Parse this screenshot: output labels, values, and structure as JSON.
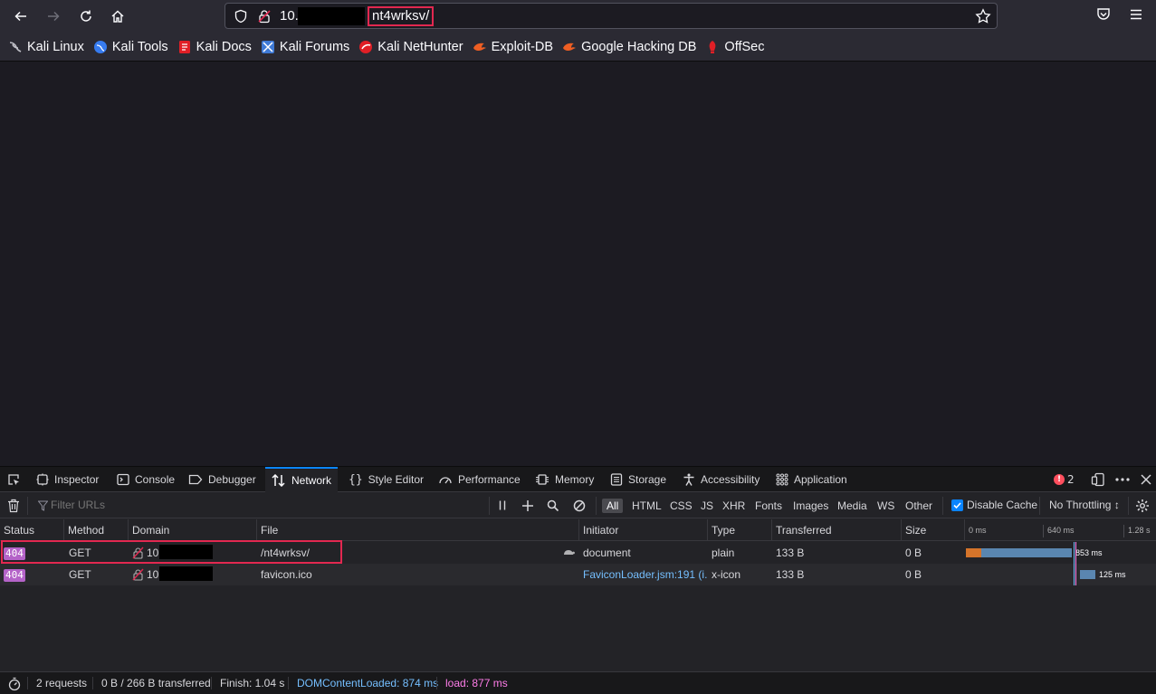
{
  "url": {
    "prefix": "10.",
    "path": "nt4wrksv/"
  },
  "bookmarks": [
    {
      "label": "Kali Linux",
      "icon": "kali-dragon-icon",
      "color": "#c0c0c8"
    },
    {
      "label": "Kali Tools",
      "icon": "kali-tools-icon",
      "color": "#367bf0"
    },
    {
      "label": "Kali Docs",
      "icon": "kali-docs-icon",
      "color": "#e01f26"
    },
    {
      "label": "Kali Forums",
      "icon": "kali-forums-icon",
      "color": "#3f7ad6"
    },
    {
      "label": "Kali NetHunter",
      "icon": "kali-nethunter-icon",
      "color": "#e01f26"
    },
    {
      "label": "Exploit-DB",
      "icon": "exploit-db-icon",
      "color": "#ee5e23"
    },
    {
      "label": "Google Hacking DB",
      "icon": "ghdb-icon",
      "color": "#ee5e23"
    },
    {
      "label": "OffSec",
      "icon": "offsec-icon",
      "color": "#e01f26"
    }
  ],
  "devtools": {
    "tabs": [
      "Inspector",
      "Console",
      "Debugger",
      "Network",
      "Style Editor",
      "Performance",
      "Memory",
      "Storage",
      "Accessibility",
      "Application"
    ],
    "active_tab": "Network",
    "error_count": "2",
    "filter_placeholder": "Filter URLs",
    "type_filters": [
      "All",
      "HTML",
      "CSS",
      "JS",
      "XHR",
      "Fonts",
      "Images",
      "Media",
      "WS",
      "Other"
    ],
    "disable_cache": "Disable Cache",
    "throttling": "No Throttling ↕",
    "columns": [
      "Status",
      "Method",
      "Domain",
      "File",
      "Initiator",
      "Type",
      "Transferred",
      "Size"
    ],
    "waterfall_ticks": [
      "0 ms",
      "640 ms",
      "1.28 s"
    ],
    "rows": [
      {
        "status": "404",
        "method": "GET",
        "domain": "10.",
        "file": "/nt4wrksv/",
        "initiator": "document",
        "type": "plain",
        "transferred": "133 B",
        "size": "0 B",
        "timing": "853 ms"
      },
      {
        "status": "404",
        "method": "GET",
        "domain": "10.",
        "file": "favicon.ico",
        "initiator": "FaviconLoader.jsm:191 (i...",
        "type": "x-icon",
        "transferred": "133 B",
        "size": "0 B",
        "timing": "125 ms"
      }
    ],
    "summary": {
      "requests": "2 requests",
      "transferred": "0 B / 266 B transferred",
      "finish": "Finish: 1.04 s",
      "dcl": "DOMContentLoaded: 874 ms",
      "load": "load: 877 ms"
    }
  },
  "colors": {
    "dcl": "#75bfff",
    "load": "#ff7de9",
    "accent": "#0a84ff",
    "highlight": "#e22850"
  }
}
